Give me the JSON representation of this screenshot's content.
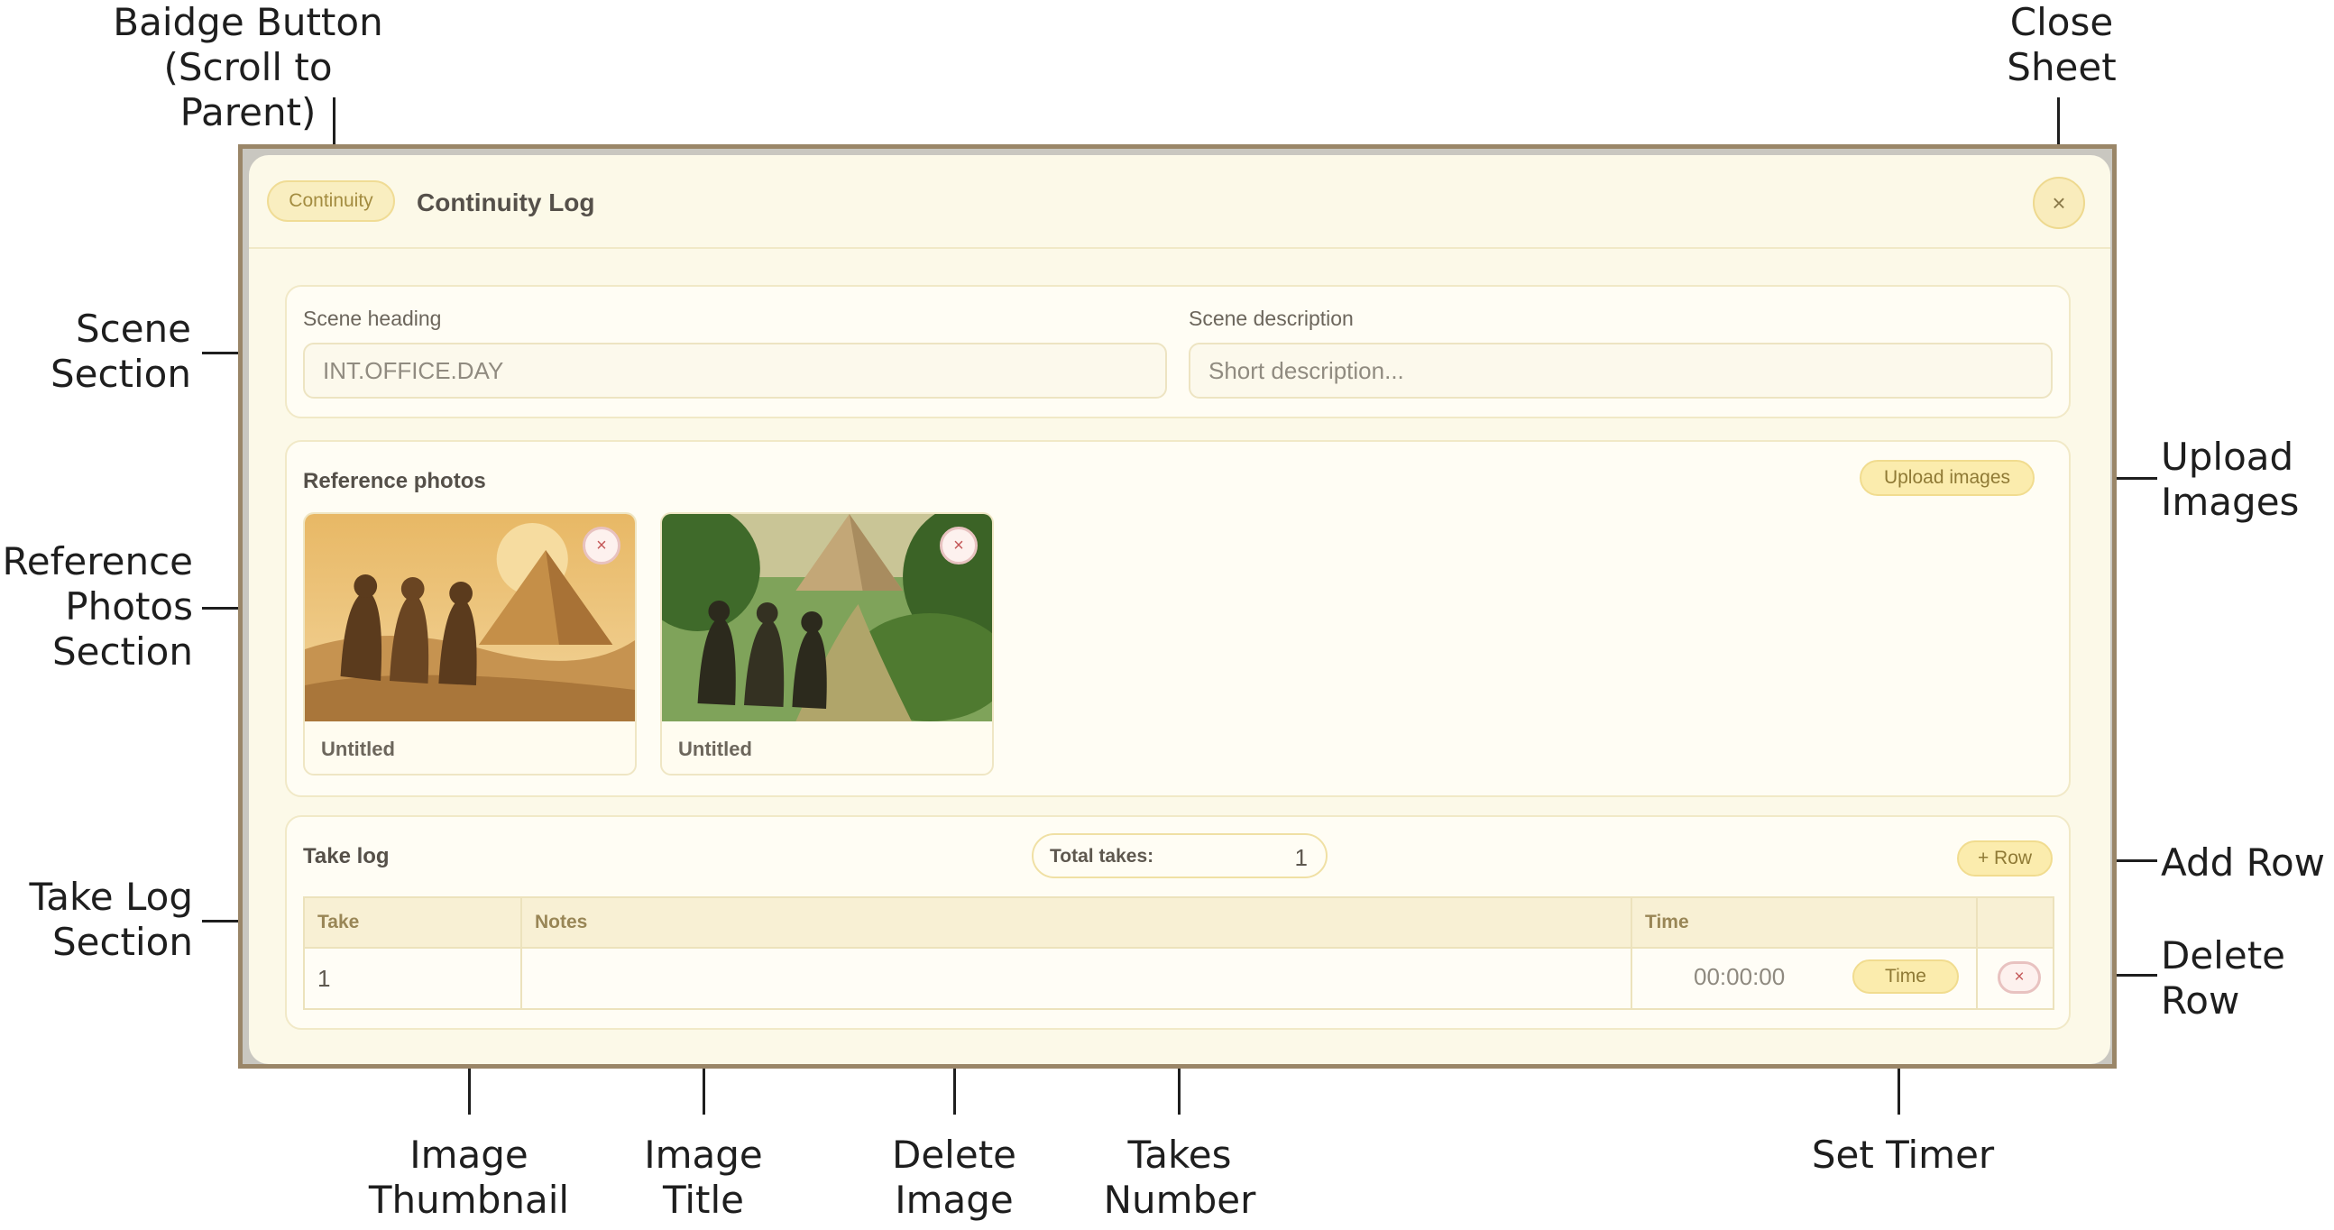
{
  "annotations": {
    "badge_button": [
      "Baidge Button",
      "(Scroll to Parent)"
    ],
    "close_sheet": [
      "Close",
      "Sheet"
    ],
    "scene_section": [
      "Scene",
      "Section"
    ],
    "reference_photos_section": [
      "Reference",
      "Photos",
      "Section"
    ],
    "take_log_section": [
      "Take Log",
      "Section"
    ],
    "upload_images": [
      "Upload",
      "Images"
    ],
    "add_row": "Add Row",
    "delete_row": [
      "Delete",
      "Row"
    ],
    "image_thumbnail": [
      "Image",
      "Thumbnail"
    ],
    "image_title": [
      "Image",
      "Title"
    ],
    "delete_image": [
      "Delete",
      "Image"
    ],
    "takes_number": [
      "Takes",
      "Number"
    ],
    "set_timer": "Set Timer"
  },
  "sheet": {
    "badge": "Continuity",
    "title": "Continuity Log",
    "close_icon": "×"
  },
  "scene": {
    "heading_label": "Scene heading",
    "heading_placeholder": "INT.OFFICE.DAY",
    "description_label": "Scene description",
    "description_placeholder": "Short description..."
  },
  "reference_photos": {
    "title": "Reference photos",
    "upload_label": "Upload images",
    "delete_icon": "×",
    "images": [
      {
        "title": "Untitled",
        "scene": "desert-pyramid-robed-figures"
      },
      {
        "title": "Untitled",
        "scene": "jungle-pyramid-robed-figures"
      }
    ]
  },
  "take_log": {
    "title": "Take log",
    "total_label": "Total takes:",
    "total_value": "1",
    "add_row_label": "+ Row",
    "columns": [
      "Take",
      "Notes",
      "Time",
      ""
    ],
    "rows": [
      {
        "take": "1",
        "notes": "",
        "time": "00:00:00",
        "time_button": "Time",
        "delete_icon": "×"
      }
    ]
  },
  "colors": {
    "accent": "#fbecad",
    "sheet_bg": "#fcf9e8",
    "frame": "#9a8668",
    "danger": "#c45858"
  }
}
